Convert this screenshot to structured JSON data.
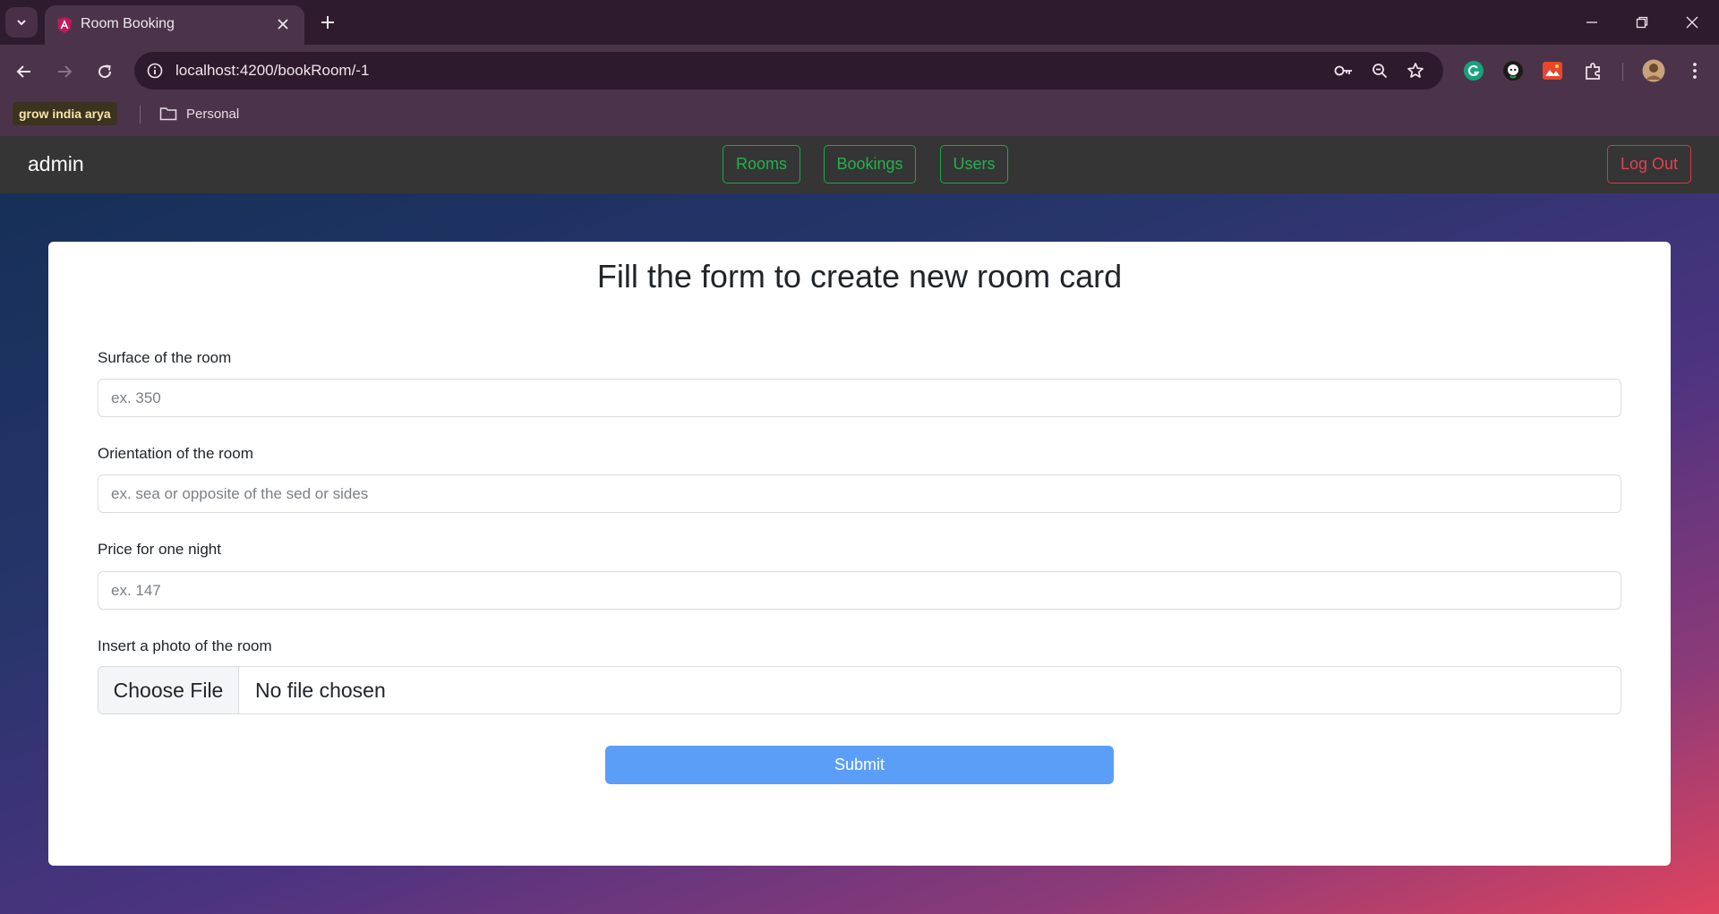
{
  "browser": {
    "tab_title": "Room Booking",
    "url": "localhost:4200/bookRoom/-1",
    "bookmarks": [
      {
        "label": "grow india arya"
      },
      {
        "label": "Personal"
      }
    ]
  },
  "app": {
    "brand": "admin",
    "nav": [
      {
        "label": "Rooms"
      },
      {
        "label": "Bookings"
      },
      {
        "label": "Users"
      }
    ],
    "logout_label": "Log Out"
  },
  "form": {
    "title": "Fill the form to create new room card",
    "fields": [
      {
        "label": "Surface of the room",
        "placeholder": "ex. 350"
      },
      {
        "label": "Orientation of the room",
        "placeholder": "ex. sea or opposite of the sed or sides"
      },
      {
        "label": "Price for one night",
        "placeholder": "ex. 147"
      }
    ],
    "photo": {
      "label": "Insert a photo of the room",
      "button_label": "Choose File",
      "status": "No file chosen"
    },
    "submit_label": "Submit"
  },
  "colors": {
    "nav_accent": "#25b04e",
    "logout_accent": "#e04353",
    "submit_bg": "#5b9ef8"
  }
}
